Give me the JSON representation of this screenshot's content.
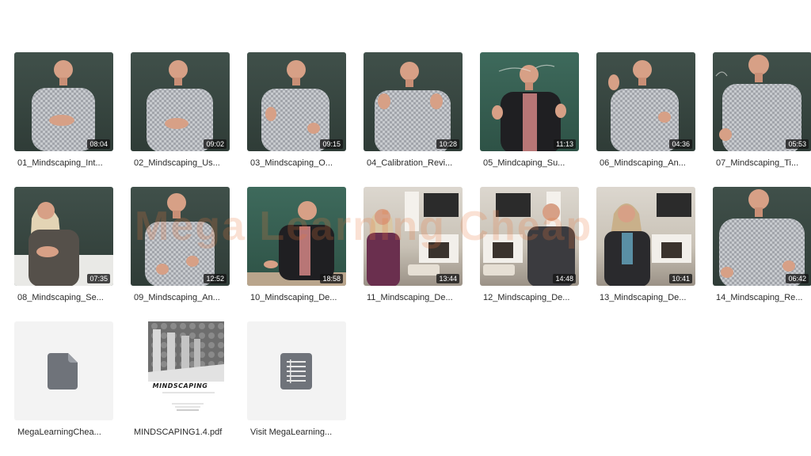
{
  "files": [
    {
      "name": "01_Mindscaping_Int...",
      "duration": "08:04",
      "kind": "video-board"
    },
    {
      "name": "02_Mindscaping_Us...",
      "duration": "09:02",
      "kind": "video-board"
    },
    {
      "name": "03_Mindscaping_O...",
      "duration": "09:15",
      "kind": "video-board"
    },
    {
      "name": "04_Calibration_Revi...",
      "duration": "10:28",
      "kind": "video-board"
    },
    {
      "name": "05_Mindcaping_Su...",
      "duration": "11:13",
      "kind": "video-green"
    },
    {
      "name": "06_Mindscaping_An...",
      "duration": "04:36",
      "kind": "video-board"
    },
    {
      "name": "07_Mindscaping_Ti...",
      "duration": "05:53",
      "kind": "video-board"
    },
    {
      "name": "08_Mindscaping_Se...",
      "duration": "07:35",
      "kind": "video-board"
    },
    {
      "name": "09_Mindscaping_An...",
      "duration": "12:52",
      "kind": "video-board"
    },
    {
      "name": "10_Mindscaping_De...",
      "duration": "18:58",
      "kind": "video-green"
    },
    {
      "name": "11_Mindscaping_De...",
      "duration": "13:44",
      "kind": "video-room"
    },
    {
      "name": "12_Mindscaping_De...",
      "duration": "14:48",
      "kind": "video-room"
    },
    {
      "name": "13_Mindscaping_De...",
      "duration": "10:41",
      "kind": "video-room"
    },
    {
      "name": "14_Mindscaping_Re...",
      "duration": "06:42",
      "kind": "video-board"
    },
    {
      "name": "MegaLearningChea...",
      "duration": "",
      "kind": "file-doc"
    },
    {
      "name": "MINDSCAPING1.4.pdf",
      "duration": "",
      "kind": "pdf"
    },
    {
      "name": "Visit MegaLearning...",
      "duration": "",
      "kind": "file-text"
    }
  ],
  "pdf_cover": {
    "title": "MINDSCAPING"
  },
  "watermark": "Mega Learning Cheap",
  "colors": {
    "shirt_check": "#c9ccd0",
    "jacket": "#222222",
    "skin": "#d9a48a"
  }
}
